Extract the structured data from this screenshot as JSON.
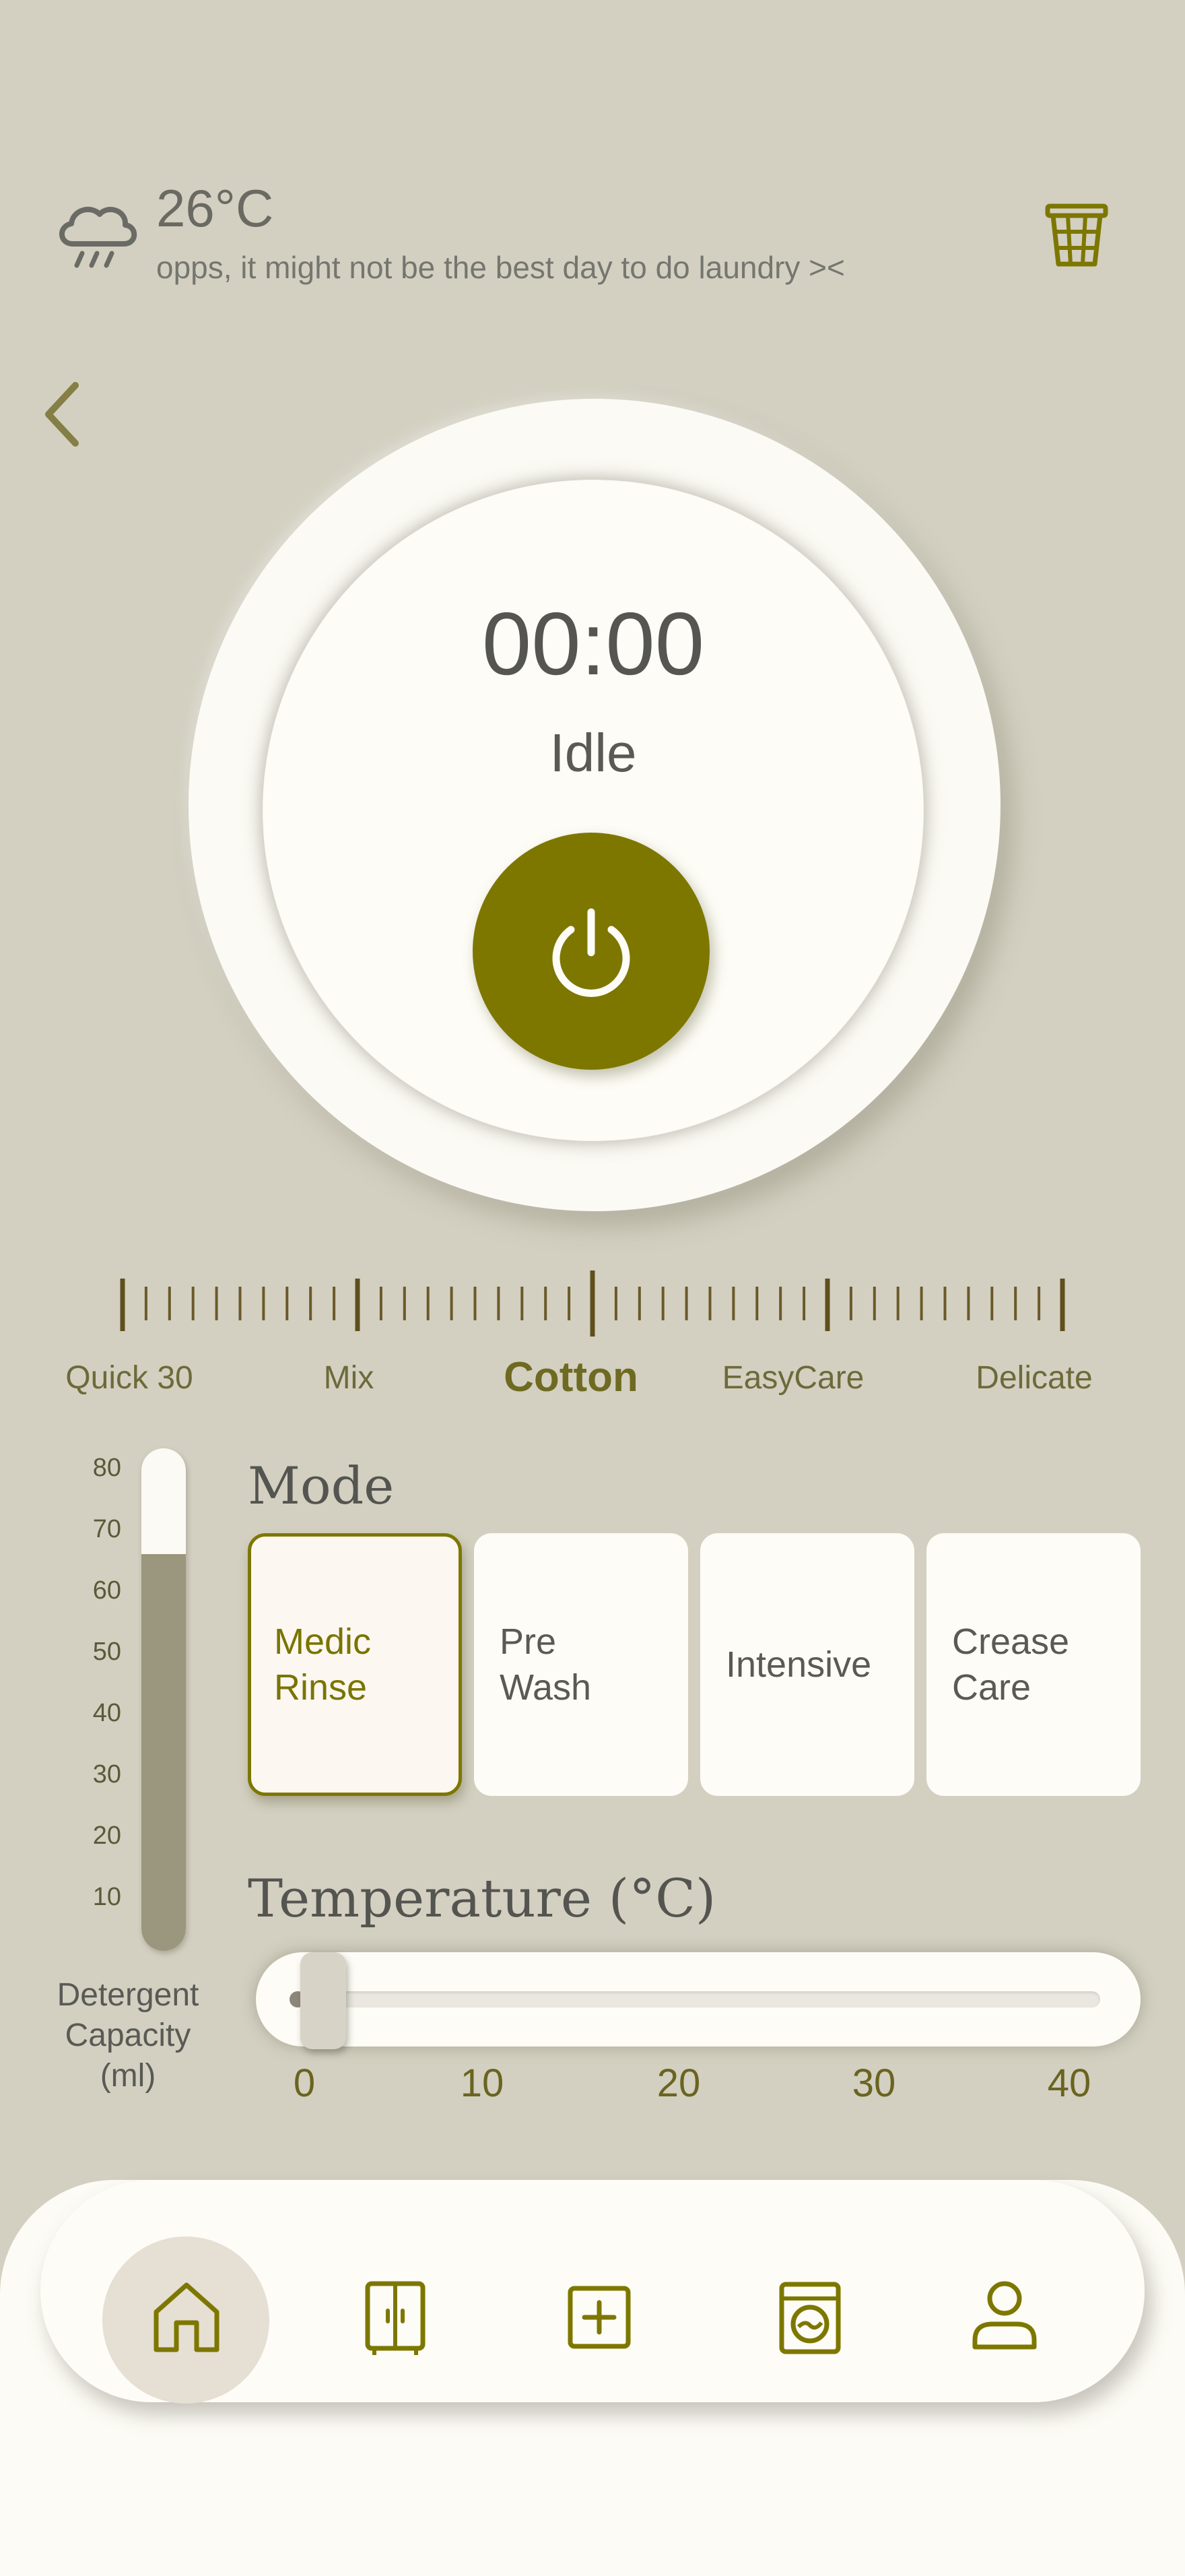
{
  "header": {
    "temperature": "26°C",
    "message": "opps, it might not be the best day to do laundry ><",
    "weather_icon": "rain-cloud-icon",
    "basket_icon": "laundry-basket-icon"
  },
  "dial": {
    "timer": "00:00",
    "status": "Idle",
    "power_icon": "power-icon"
  },
  "programs": {
    "items": [
      "Quick 30",
      "Mix",
      "Cotton",
      "EasyCare",
      "Delicate"
    ],
    "selected": "Cotton"
  },
  "detergent": {
    "ticks": [
      "80",
      "70",
      "60",
      "50",
      "40",
      "30",
      "20",
      "10"
    ],
    "label_line1": "Detergent",
    "label_line2": "Capacity",
    "label_line3": "(ml)",
    "level_fraction": 0.79
  },
  "mode": {
    "title": "Mode",
    "cards": [
      {
        "line1": "Medic",
        "line2": "Rinse"
      },
      {
        "line1": "Pre",
        "line2": "Wash"
      },
      {
        "line1": "Intensive",
        "line2": ""
      },
      {
        "line1": "Crease",
        "line2": "Care"
      }
    ],
    "selected_index": 0
  },
  "temperature": {
    "title": "Temperature (°C)",
    "ticks": [
      "0",
      "10",
      "20",
      "30",
      "40"
    ],
    "value": 0
  },
  "nav": {
    "items": [
      "home-icon",
      "wardrobe-icon",
      "add-icon",
      "washing-machine-icon",
      "profile-icon"
    ],
    "active": "home-icon"
  },
  "colors": {
    "background": "#d3d0c1",
    "accent": "#7d7700",
    "surface": "#fdfcf6"
  }
}
